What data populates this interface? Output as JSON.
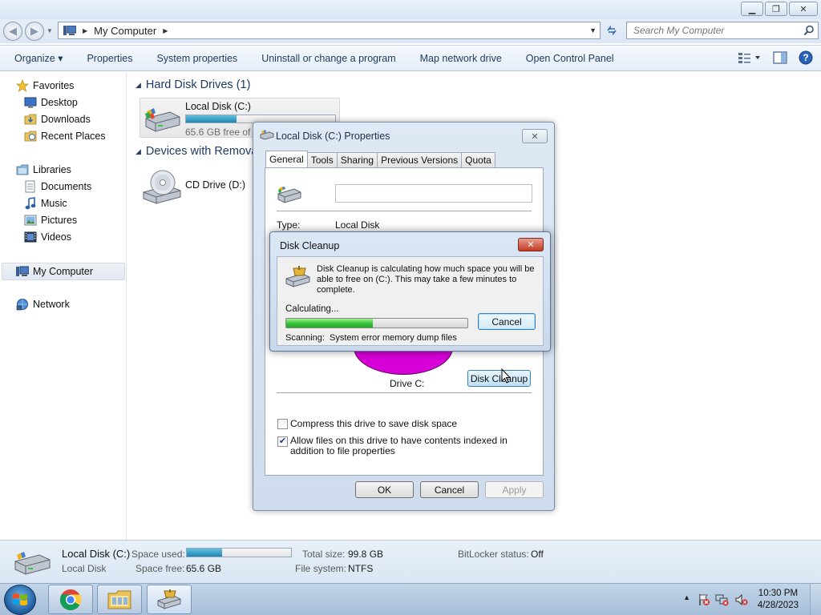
{
  "window": {
    "minimize_glyph": "▁",
    "restore_glyph": "❐",
    "close_glyph": "✕"
  },
  "address": {
    "back_glyph": "◀",
    "forward_glyph": "▶",
    "path_label": "My Computer",
    "separator": "▶",
    "search_placeholder": "Search My Computer"
  },
  "toolbar": {
    "items": [
      "Organize ▾",
      "Properties",
      "System properties",
      "Uninstall or change a program",
      "Map network drive",
      "Open Control Panel"
    ]
  },
  "nav": {
    "favorites": "Favorites",
    "desktop": "Desktop",
    "downloads": "Downloads",
    "recent_places": "Recent Places",
    "libraries": "Libraries",
    "documents": "Documents",
    "music": "Music",
    "pictures": "Pictures",
    "videos": "Videos",
    "my_computer": "My Computer",
    "network": "Network"
  },
  "content": {
    "hdd_group": "Hard Disk Drives (1)",
    "removable_group": "Devices with Removable Storage (1)",
    "local_disk_name": "Local Disk (C:)",
    "local_disk_free": "65.6 GB free of 99.8 GB",
    "local_disk_used_fraction": 0.34,
    "cd_drive_name": "CD Drive (D:)"
  },
  "details": {
    "name": "Local Disk (C:)",
    "type": "Local Disk",
    "space_used_label": "Space used:",
    "space_free_label": "Space free:",
    "space_free_value": "65.6 GB",
    "total_size_label": "Total size:",
    "total_size_value": "99.8 GB",
    "filesystem_label": "File system:",
    "filesystem_value": "NTFS",
    "bitlocker_label": "BitLocker status:",
    "bitlocker_value": "Off",
    "used_fraction": 0.34
  },
  "taskbar": {
    "time": "10:30 PM",
    "date": "4/28/2023",
    "tray_arrow": "▲"
  },
  "properties_dialog": {
    "title": "Local Disk (C:) Properties",
    "close_glyph": "✕",
    "tabs": [
      "General",
      "Tools",
      "Sharing",
      "Previous Versions",
      "Quota"
    ],
    "label_value": "",
    "type_label": "Type:",
    "type_value": "Local Disk",
    "drive_label": "Drive C:",
    "disk_cleanup_button": "Disk Cleanup",
    "compress_label": "Compress this drive to save disk space",
    "compress_checked": false,
    "index_label": "Allow files on this drive to have contents indexed in addition to file properties",
    "index_checked": true,
    "check_glyph": "✔",
    "ok": "OK",
    "cancel": "Cancel",
    "apply": "Apply"
  },
  "cleanup_dialog": {
    "title": "Disk Cleanup",
    "close_glyph": "✕",
    "message": "Disk Cleanup is calculating how much space you will be able to free on  (C:). This may take a few minutes to complete.",
    "calculating": "Calculating...",
    "cancel": "Cancel",
    "progress_fraction": 0.48,
    "scanning_label": "Scanning:",
    "scanning_item": "System error memory dump files"
  }
}
